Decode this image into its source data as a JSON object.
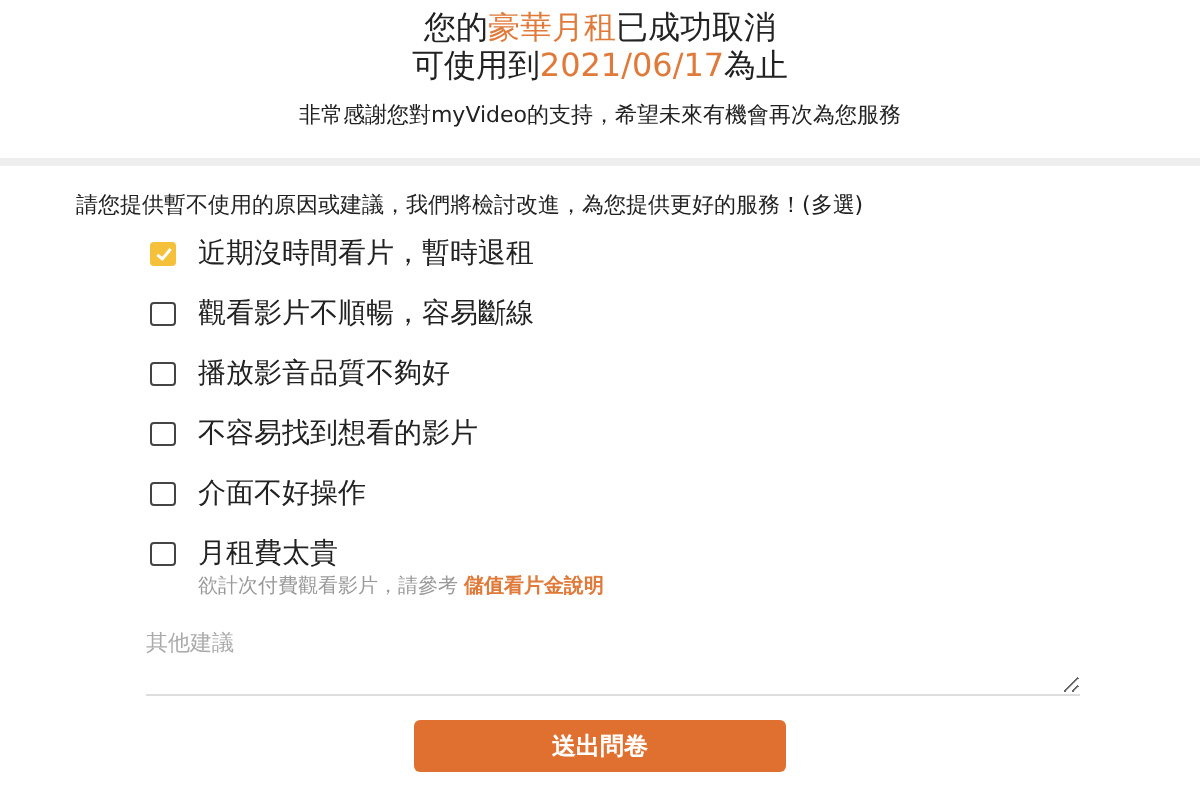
{
  "header": {
    "lines": [
      [
        {
          "text": "您的",
          "highlight": false
        },
        {
          "text": "豪華月租",
          "highlight": true
        },
        {
          "text": "已成功取消",
          "highlight": false
        }
      ],
      [
        {
          "text": "可使用到",
          "highlight": false
        },
        {
          "text": "2021/06/17",
          "highlight": true
        },
        {
          "text": "為止",
          "highlight": false
        }
      ]
    ],
    "thanks": "非常感謝您對myVideo的支持，希望未來有機會再次為您服務"
  },
  "survey": {
    "question": "請您提供暫不使用的原因或建議，我們將檢討改進，為您提供更好的服務！(多選)",
    "options": [
      {
        "label": "近期沒時間看片，暫時退租",
        "checked": true
      },
      {
        "label": "觀看影片不順暢，容易斷線",
        "checked": false
      },
      {
        "label": "播放影音品質不夠好",
        "checked": false
      },
      {
        "label": "不容易找到想看的影片",
        "checked": false
      },
      {
        "label": "介面不好操作",
        "checked": false
      },
      {
        "label": "月租費太貴",
        "checked": false,
        "hint": "欲計次付費觀看影片，請參考",
        "hint_link": "儲值看片金說明"
      }
    ],
    "comment": {
      "placeholder": "其他建議"
    },
    "submit": "送出問卷"
  }
}
